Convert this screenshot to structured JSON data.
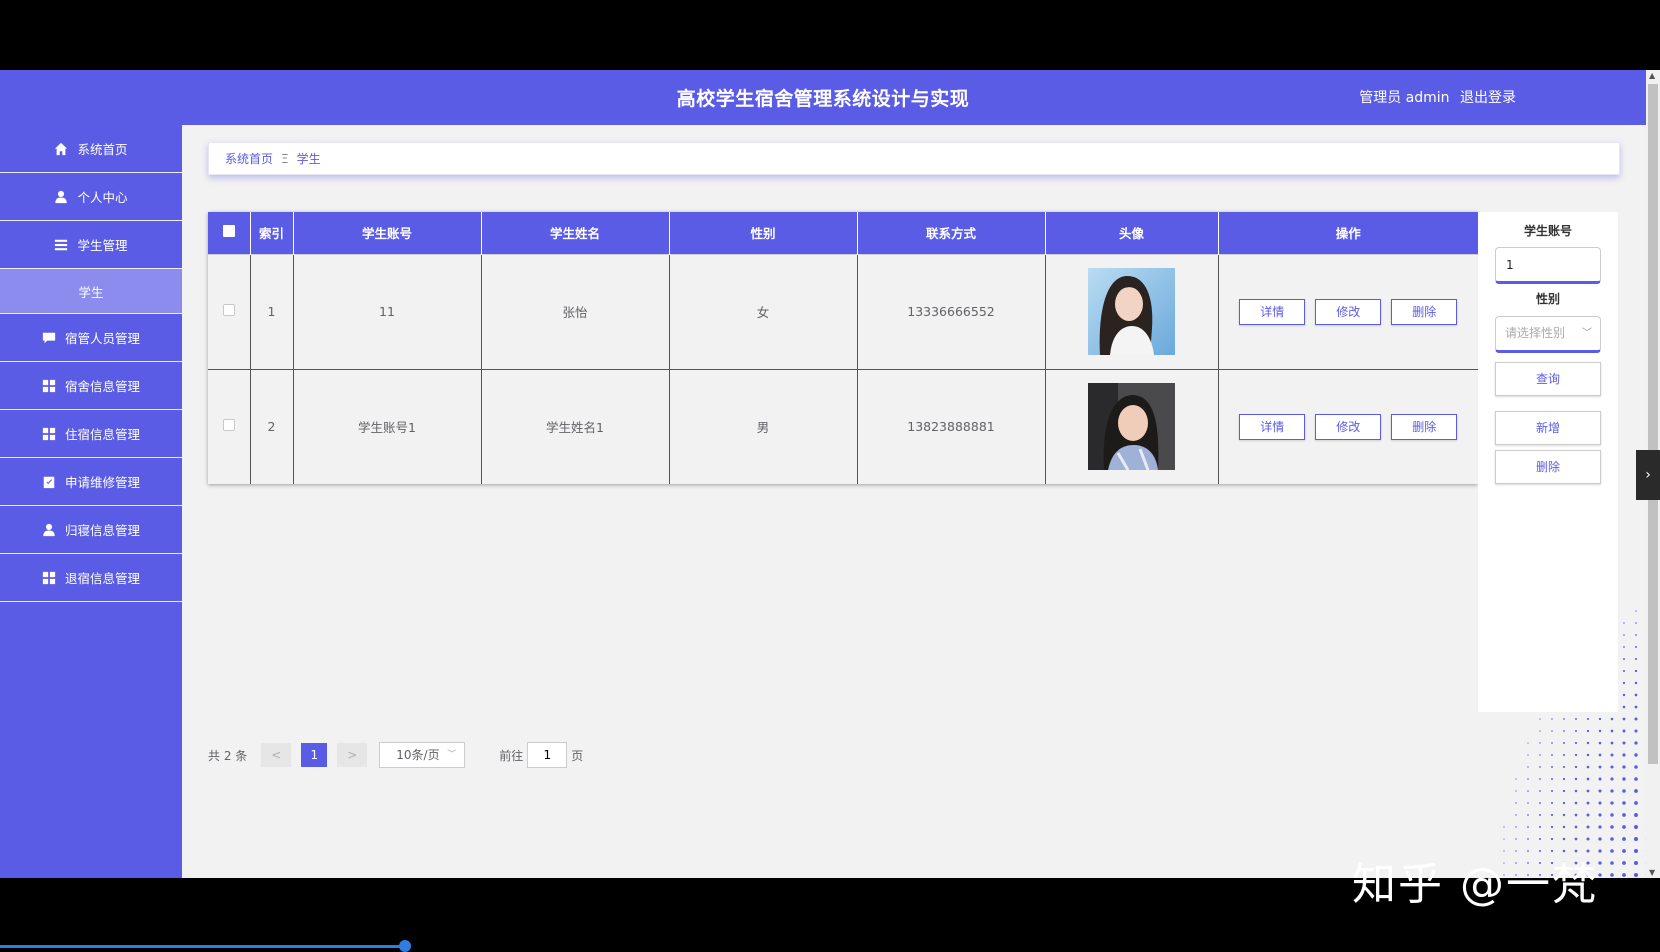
{
  "header": {
    "title": "高校学生宿舍管理系统设计与实现",
    "role_label": "管理员 admin",
    "logout_label": "退出登录"
  },
  "sidebar": {
    "items": [
      {
        "label": "系统首页",
        "icon": "home-icon"
      },
      {
        "label": "个人中心",
        "icon": "user-icon"
      },
      {
        "label": "学生管理",
        "icon": "list-icon"
      },
      {
        "label": "学生",
        "icon": ""
      },
      {
        "label": "宿管人员管理",
        "icon": "chat-icon"
      },
      {
        "label": "宿舍信息管理",
        "icon": "grid-icon"
      },
      {
        "label": "住宿信息管理",
        "icon": "grid-icon"
      },
      {
        "label": "申请维修管理",
        "icon": "clipboard-icon"
      },
      {
        "label": "归寝信息管理",
        "icon": "user-icon"
      },
      {
        "label": "退宿信息管理",
        "icon": "grid-icon"
      }
    ]
  },
  "breadcrumb": {
    "home": "系统首页",
    "separator": "Ξ",
    "current": "学生"
  },
  "table": {
    "columns": [
      "索引",
      "学生账号",
      "学生姓名",
      "性别",
      "联系方式",
      "头像",
      "操作"
    ],
    "rows": [
      {
        "index": "1",
        "account": "11",
        "name": "张怡",
        "gender": "女",
        "phone": "13336666552"
      },
      {
        "index": "2",
        "account": "学生账号1",
        "name": "学生姓名1",
        "gender": "男",
        "phone": "13823888881"
      }
    ],
    "actions": {
      "detail": "详情",
      "edit": "修改",
      "delete": "删除"
    }
  },
  "search": {
    "account_label": "学生账号",
    "account_value": "1",
    "gender_label": "性别",
    "gender_placeholder": "请选择性别",
    "query_button": "查询",
    "add_button": "新增",
    "delete_button": "删除"
  },
  "pagination": {
    "total": "共 2 条",
    "prev": "<",
    "current_page": "1",
    "next": ">",
    "page_size": "10条/页",
    "goto_label": "前往",
    "goto_value": "1",
    "page_suffix": "页"
  },
  "watermark": "知乎 @一梵",
  "colors": {
    "primary": "#5b5ce6",
    "sidebar_active": "#8b8cee",
    "background": "#f2f2f2"
  }
}
